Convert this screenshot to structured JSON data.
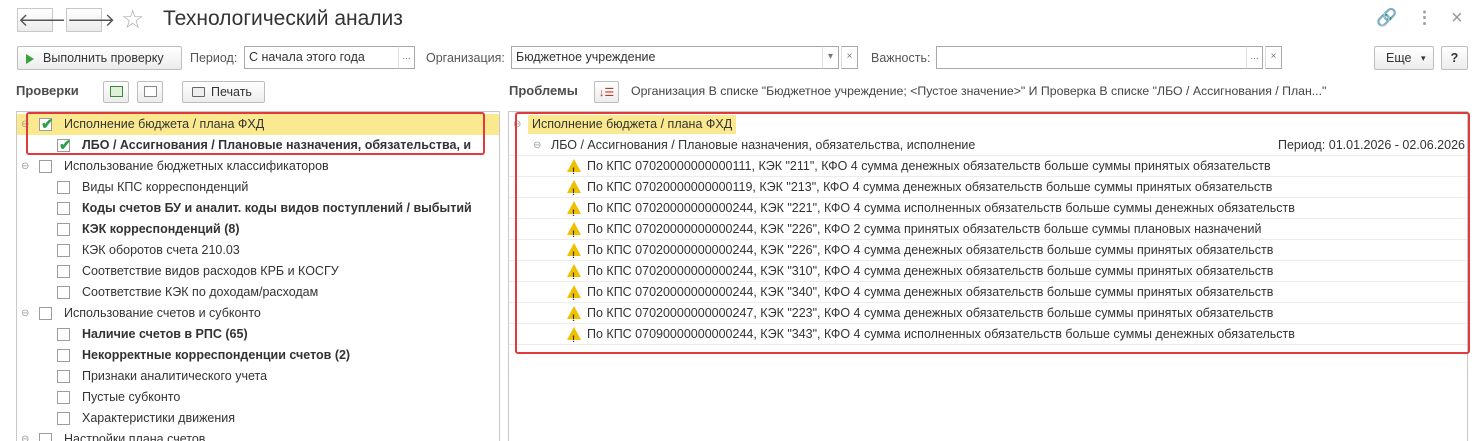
{
  "window": {
    "title": "Технологический анализ",
    "back_glyph": "🡐",
    "forward_glyph": "🡒",
    "star_glyph": "☆",
    "link_glyph": "🔗",
    "more_glyph": "⋮",
    "close_glyph": "×"
  },
  "toolbar": {
    "run_label": "Выполнить проверку",
    "period_label": "Период:",
    "period_value": "С начала этого года",
    "org_label": "Организация:",
    "org_value": "Бюджетное учреждение",
    "importance_label": "Важность:",
    "importance_value": "",
    "more_label": "Еще",
    "help_label": "?",
    "select_glyph": "...",
    "dropdown_glyph": "▾",
    "clear_glyph": "×"
  },
  "checks": {
    "title": "Проверки",
    "print_label": "Печать",
    "items": [
      {
        "label": "Исполнение бюджета / плана ФХД",
        "checked": true,
        "bold": false,
        "group": true
      },
      {
        "label": "ЛБО / Ассигнования / Плановые назначения, обязательства, и",
        "checked": true,
        "bold": true,
        "group": false
      },
      {
        "label": "Использование бюджетных классификаторов",
        "checked": false,
        "bold": false,
        "group": true
      },
      {
        "label": "Виды КПС корреспонденций",
        "checked": false,
        "bold": false,
        "group": false
      },
      {
        "label": "Коды счетов БУ и аналит. коды видов поступлений / выбытий",
        "checked": false,
        "bold": true,
        "group": false
      },
      {
        "label": "КЭК корреспонденций (8)",
        "checked": false,
        "bold": true,
        "group": false
      },
      {
        "label": "КЭК оборотов счета 210.03",
        "checked": false,
        "bold": false,
        "group": false
      },
      {
        "label": "Соответствие видов расходов КРБ и КОСГУ",
        "checked": false,
        "bold": false,
        "group": false
      },
      {
        "label": "Соответствие КЭК по доходам/расходам",
        "checked": false,
        "bold": false,
        "group": false
      },
      {
        "label": "Использование счетов и субконто",
        "checked": false,
        "bold": false,
        "group": true
      },
      {
        "label": "Наличие счетов в РПС (65)",
        "checked": false,
        "bold": true,
        "group": false
      },
      {
        "label": "Некорректные корреспонденции счетов (2)",
        "checked": false,
        "bold": true,
        "group": false
      },
      {
        "label": "Признаки аналитического учета",
        "checked": false,
        "bold": false,
        "group": false
      },
      {
        "label": "Пустые субконто",
        "checked": false,
        "bold": false,
        "group": false
      },
      {
        "label": "Характеристики движения",
        "checked": false,
        "bold": false,
        "group": false
      },
      {
        "label": "Настройки плана счетов",
        "checked": false,
        "bold": false,
        "group": true
      }
    ]
  },
  "problems": {
    "title": "Проблемы",
    "filter_text": "Организация В списке \"Бюджетное учреждение; <Пустое значение>\" И Проверка В списке \"ЛБО / Ассигнования / План...\"",
    "group_label": "Исполнение бюджета / плана ФХД",
    "subgroup_label": "ЛБО / Ассигнования / Плановые назначения, обязательства, исполнение",
    "period_text": "Период: 01.01.2026 - 02.06.2026",
    "items": [
      "По КПС 07020000000000111, КЭК \"211\", КФО 4 сумма денежных обязательств больше суммы принятых обязательств",
      "По КПС 07020000000000119, КЭК \"213\", КФО 4 сумма денежных обязательств больше суммы принятых обязательств",
      "По КПС 07020000000000244, КЭК \"221\", КФО 4 сумма исполненных обязательств больше суммы денежных обязательств",
      "По КПС 07020000000000244, КЭК \"226\", КФО 2 сумма принятых обязательств больше суммы плановых назначений",
      "По КПС 07020000000000244, КЭК \"226\", КФО 4 сумма денежных обязательств больше суммы принятых обязательств",
      "По КПС 07020000000000244, КЭК \"310\", КФО 4 сумма денежных обязательств больше суммы принятых обязательств",
      "По КПС 07020000000000244, КЭК \"340\", КФО 4 сумма денежных обязательств больше суммы принятых обязательств",
      "По КПС 07020000000000247, КЭК \"223\", КФО 4 сумма денежных обязательств больше суммы принятых обязательств",
      "По КПС 07090000000000244, КЭК \"343\", КФО 4 сумма исполненных обязательств больше суммы денежных обязательств"
    ]
  },
  "colors": {
    "highlight_row": "#fbe98f",
    "annotation_red": "#e0393e",
    "check_green": "#2ea043",
    "warning_yellow": "#f0c000"
  }
}
